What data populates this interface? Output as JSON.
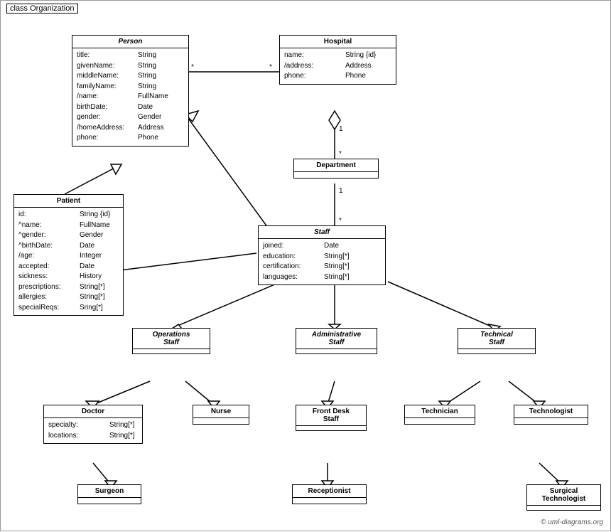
{
  "diagram": {
    "title": "class Organization",
    "classes": {
      "person": {
        "name": "Person",
        "italic": true,
        "attrs": [
          {
            "name": "title:",
            "type": "String"
          },
          {
            "name": "givenName:",
            "type": "String"
          },
          {
            "name": "middleName:",
            "type": "String"
          },
          {
            "name": "familyName:",
            "type": "String"
          },
          {
            "name": "/name:",
            "type": "FullName"
          },
          {
            "name": "birthDate:",
            "type": "Date"
          },
          {
            "name": "gender:",
            "type": "Gender"
          },
          {
            "name": "/homeAddress:",
            "type": "Address"
          },
          {
            "name": "phone:",
            "type": "Phone"
          }
        ]
      },
      "hospital": {
        "name": "Hospital",
        "italic": false,
        "attrs": [
          {
            "name": "name:",
            "type": "String {id}"
          },
          {
            "name": "/address:",
            "type": "Address"
          },
          {
            "name": "phone:",
            "type": "Phone"
          }
        ]
      },
      "patient": {
        "name": "Patient",
        "italic": false,
        "attrs": [
          {
            "name": "id:",
            "type": "String {id}"
          },
          {
            "name": "^name:",
            "type": "FullName"
          },
          {
            "name": "^gender:",
            "type": "Gender"
          },
          {
            "name": "^birthDate:",
            "type": "Date"
          },
          {
            "name": "/age:",
            "type": "Integer"
          },
          {
            "name": "accepted:",
            "type": "Date"
          },
          {
            "name": "sickness:",
            "type": "History"
          },
          {
            "name": "prescriptions:",
            "type": "String[*]"
          },
          {
            "name": "allergies:",
            "type": "String[*]"
          },
          {
            "name": "specialReqs:",
            "type": "Sring[*]"
          }
        ]
      },
      "department": {
        "name": "Department",
        "italic": false,
        "attrs": []
      },
      "staff": {
        "name": "Staff",
        "italic": true,
        "attrs": [
          {
            "name": "joined:",
            "type": "Date"
          },
          {
            "name": "education:",
            "type": "String[*]"
          },
          {
            "name": "certification:",
            "type": "String[*]"
          },
          {
            "name": "languages:",
            "type": "String[*]"
          }
        ]
      },
      "operationsStaff": {
        "name": "Operations\nStaff",
        "italic": true,
        "attrs": []
      },
      "administrativeStaff": {
        "name": "Administrative\nStaff",
        "italic": true,
        "attrs": []
      },
      "technicalStaff": {
        "name": "Technical\nStaff",
        "italic": true,
        "attrs": []
      },
      "doctor": {
        "name": "Doctor",
        "italic": false,
        "attrs": [
          {
            "name": "specialty:",
            "type": "String[*]"
          },
          {
            "name": "locations:",
            "type": "String[*]"
          }
        ]
      },
      "nurse": {
        "name": "Nurse",
        "italic": false,
        "attrs": []
      },
      "frontDeskStaff": {
        "name": "Front Desk\nStaff",
        "italic": false,
        "attrs": []
      },
      "technician": {
        "name": "Technician",
        "italic": false,
        "attrs": []
      },
      "technologist": {
        "name": "Technologist",
        "italic": false,
        "attrs": []
      },
      "surgeon": {
        "name": "Surgeon",
        "italic": false,
        "attrs": []
      },
      "receptionist": {
        "name": "Receptionist",
        "italic": false,
        "attrs": []
      },
      "surgicalTechnologist": {
        "name": "Surgical\nTechnologist",
        "italic": false,
        "attrs": []
      }
    },
    "copyright": "© uml-diagrams.org"
  }
}
